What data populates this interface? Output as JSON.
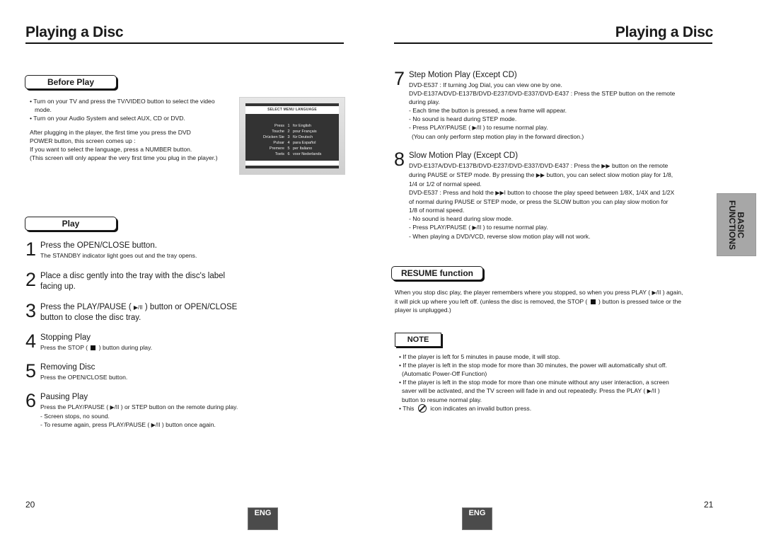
{
  "left_page": {
    "title": "Playing a Disc",
    "before_play": {
      "label": "Before Play",
      "bullets": [
        "• Turn on your TV and press the TV/VIDEO button to select the video",
        "mode.",
        "• Turn on your Audio System and select AUX, CD or DVD."
      ],
      "para": [
        "After plugging in the player, the first time you press the DVD",
        "POWER button, this screen comes up :",
        "If you want to select the language, press a NUMBER button.",
        "(This screen will only appear the very first time you plug in the player.)"
      ]
    },
    "tv_screen": {
      "header": "SELECT MENU LANGUAGE",
      "rows": [
        {
          "verb": "Press",
          "num": "1",
          "lang": "for English"
        },
        {
          "verb": "Touche",
          "num": "2",
          "lang": "pour Français"
        },
        {
          "verb": "Drücken Sie",
          "num": "3",
          "lang": "für Deutsch"
        },
        {
          "verb": "Pulsar",
          "num": "4",
          "lang": "para Español"
        },
        {
          "verb": "Premere",
          "num": "5",
          "lang": "per Italiano"
        },
        {
          "verb": "Toets",
          "num": "6",
          "lang": "voor Nederlands"
        }
      ]
    },
    "play": {
      "label": "Play",
      "steps": [
        {
          "num": "1",
          "head": "Press the OPEN/CLOSE button.",
          "lines": [
            "The STANDBY indicator light goes out and the tray opens."
          ]
        },
        {
          "num": "2",
          "head": "Place a disc gently into the tray with the disc's label",
          "head2": "facing up."
        },
        {
          "num": "3",
          "head_a": "Press the PLAY/PAUSE ( ",
          "sym": "▶/II",
          "head_b": " ) button or OPEN/CLOSE",
          "head2": "button to close the disc tray."
        },
        {
          "num": "4",
          "head": "Stopping Play",
          "line_a": "Press the STOP ( ",
          "line_b": " ) button during play."
        },
        {
          "num": "5",
          "head": "Removing Disc",
          "lines": [
            "Press the OPEN/CLOSE button."
          ]
        },
        {
          "num": "6",
          "head": "Pausing Play",
          "line1_a": "Press the PLAY/PAUSE ( ",
          "line1_b": " ) or STEP button on the remote during play.",
          "line2": "- Screen stops, no sound.",
          "line3_a": "- To resume again, press PLAY/PAUSE ( ",
          "line3_b": " ) button once again."
        }
      ]
    },
    "page_number": "20",
    "lang_tab": "ENG"
  },
  "right_page": {
    "title": "Playing a Disc",
    "step7": {
      "num": "7",
      "head": "Step Motion Play (Except CD)",
      "lines": [
        "DVD-E537 : If turning Jog Dial, you can view one by one.",
        "DVD-E137A/DVD-E137B/DVD-E237/DVD-E337/DVD-E437 : Press the STEP button on the remote",
        "during play.",
        "- Each time the button is pressed, a new frame will appear.",
        "- No sound is heard during STEP mode."
      ],
      "resume_a": "- Press PLAY/PAUSE ( ",
      "resume_b": " ) to resume normal play.",
      "last": "(You can only perform step motion play in the forward direction.)"
    },
    "step8": {
      "num": "8",
      "head": "Slow Motion Play (Except CD)",
      "l1_a": "DVD-E137A/DVD-E137B/DVD-E237/DVD-E337/DVD-E437 : Press the ",
      "l1_b": " button on the remote",
      "l2_a": "during PAUSE or STEP mode. By pressing the ",
      "l2_b": " button, you can select slow motion play for 1/8,",
      "l3": "1/4 or 1/2 of normal speed.",
      "l4_a": "DVD-E537 : Press and hold the ",
      "l4_b": " button to choose the play speed between 1/8X, 1/4X and 1/2X",
      "l5": "of normal during PAUSE or STEP mode, or press the SLOW button you can play slow motion for",
      "l6": "1/8 of normal speed.",
      "l7": "- No sound is heard during slow mode.",
      "l8_a": "- Press PLAY/PAUSE ( ",
      "l8_b": " ) to resume normal play.",
      "l9": "- When playing a DVD/VCD, reverse slow motion play will not work."
    },
    "resume": {
      "label": "RESUME function",
      "l1_a": "When you stop disc play, the player remembers where you stopped, so when you press PLAY ( ",
      "l1_b": " ) again,",
      "l2_a": "it will pick up where you left off. (unless the disc is removed, the STOP ( ",
      "l2_b": " ) button is pressed twice or the",
      "l3": "player is unplugged.)"
    },
    "note": {
      "label": "NOTE",
      "b1": "• If the player is left for 5 minutes in pause mode, it will stop.",
      "b2": "• If the player is left in the stop mode for more than 30 minutes, the power will automatically shut off.",
      "b2b": "(Automatic Power-Off Function)",
      "b3": "• If the player is left in the stop mode for more than one minute without any user interaction, a screen",
      "b3b_a": "saver will be activated, and the TV screen will fade in and out repeatedly. Press the PLAY ( ",
      "b3b_b": " )",
      "b3c": "button to resume normal play.",
      "b4_a": "• This ",
      "b4_b": " icon indicates an invalid button press."
    },
    "side_tab": [
      "BASIC",
      "FUNCTIONS"
    ],
    "page_number": "21",
    "lang_tab": "ENG"
  },
  "symbols": {
    "play_pause": "▶/II",
    "fast_forward": "▶▶",
    "skip_forward": "▶▶I"
  }
}
